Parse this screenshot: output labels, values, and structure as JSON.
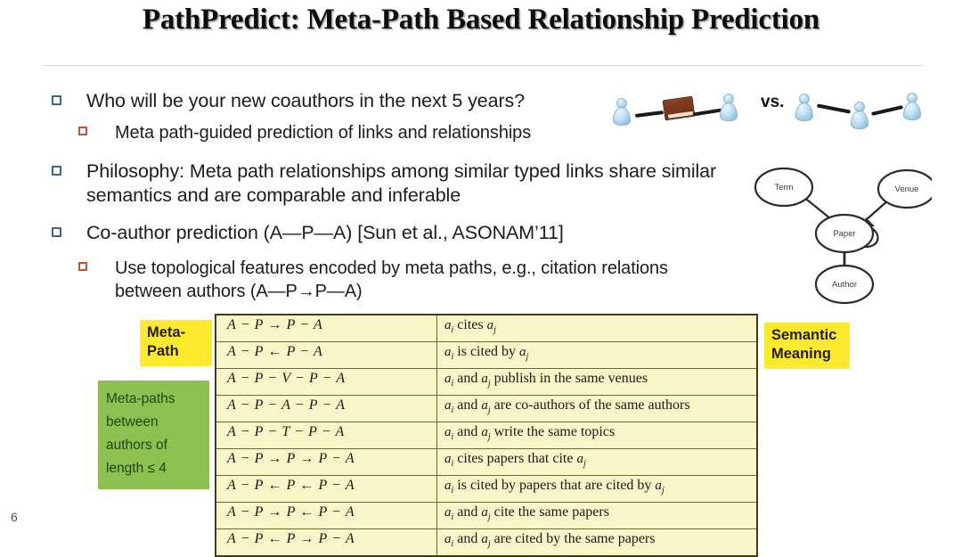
{
  "slide": {
    "title": "PathPredict: Meta-Path Based Relationship Prediction",
    "page_number": "6"
  },
  "bullets": [
    {
      "level": 1,
      "text": "Who will be your new coauthors in the next 5 years?",
      "marker": "hollow-square-blue"
    },
    {
      "level": 2,
      "text": "Meta path-guided prediction of links and relationships",
      "marker": "hollow-square-orange"
    },
    {
      "level": 1,
      "text": "Philosophy: Meta path relationships among similar typed links share similar semantics and are comparable and inferable",
      "marker": "hollow-square-blue"
    },
    {
      "level": 1,
      "text": "Co-author prediction (A—P—A) [Sun et al., ASONAM’11]",
      "marker": "hollow-square-blue"
    },
    {
      "level": 2,
      "text": "Use topological features encoded by meta paths, e.g., citation relations between authors (A—P→P—A)",
      "marker": "hollow-square-orange"
    }
  ],
  "illustration": {
    "vs_label": "vs.",
    "left_group_people": 2,
    "right_group_people": 3,
    "book_icon": "book-icon"
  },
  "schema": {
    "nodes": [
      {
        "id": "term",
        "label": "Term"
      },
      {
        "id": "venue",
        "label": "Venue"
      },
      {
        "id": "paper",
        "label": "Paper"
      },
      {
        "id": "author",
        "label": "Author"
      }
    ],
    "edges": [
      {
        "from": "term",
        "to": "paper"
      },
      {
        "from": "venue",
        "to": "paper"
      },
      {
        "from": "author",
        "to": "paper"
      },
      {
        "from": "paper",
        "to": "paper",
        "self_loop": true
      }
    ]
  },
  "callouts": {
    "meta_path_tag": "Meta-Path",
    "semantic_meaning_tag": "Semantic Meaning",
    "meta_paths_note": "Meta-paths between authors of length ≤ 4",
    "highlight_color": "#ffe92e",
    "note_color": "#8cc152"
  },
  "table": {
    "column_headers": [
      "Meta-Path",
      "Semantic Meaning"
    ],
    "rows": [
      {
        "path": "A − P → P − A",
        "meaning_html": "<span class=\"sub\">a<sub>i</sub></span> cites <span class=\"sub\">a<sub>j</sub></span>"
      },
      {
        "path": "A − P ← P − A",
        "meaning_html": "<span class=\"sub\">a<sub>i</sub></span> is cited by <span class=\"sub\">a<sub>j</sub></span>"
      },
      {
        "path": "A − P − V − P − A",
        "meaning_html": "<span class=\"sub\">a<sub>i</sub></span> and <span class=\"sub\">a<sub>j</sub></span> publish in the same venues"
      },
      {
        "path": "A − P − A − P − A",
        "meaning_html": "<span class=\"sub\">a<sub>i</sub></span> and <span class=\"sub\">a<sub>j</sub></span> are co-authors of the same authors"
      },
      {
        "path": "A − P − T − P − A",
        "meaning_html": "<span class=\"sub\">a<sub>i</sub></span> and <span class=\"sub\">a<sub>j</sub></span> write the same topics"
      },
      {
        "path": "A − P → P → P − A",
        "meaning_html": "<span class=\"sub\">a<sub>i</sub></span> cites papers that cite <span class=\"sub\">a<sub>j</sub></span>"
      },
      {
        "path": "A − P ← P ← P − A",
        "meaning_html": "<span class=\"sub\">a<sub>i</sub></span> is cited by papers that are cited by <span class=\"sub\">a<sub>j</sub></span>"
      },
      {
        "path": "A − P → P ← P − A",
        "meaning_html": "<span class=\"sub\">a<sub>i</sub></span> and <span class=\"sub\">a<sub>j</sub></span> cite the same papers"
      },
      {
        "path": "A − P ← P → P − A",
        "meaning_html": "<span class=\"sub\">a<sub>i</sub></span> and <span class=\"sub\">a<sub>j</sub></span> are cited by the same papers"
      }
    ]
  }
}
